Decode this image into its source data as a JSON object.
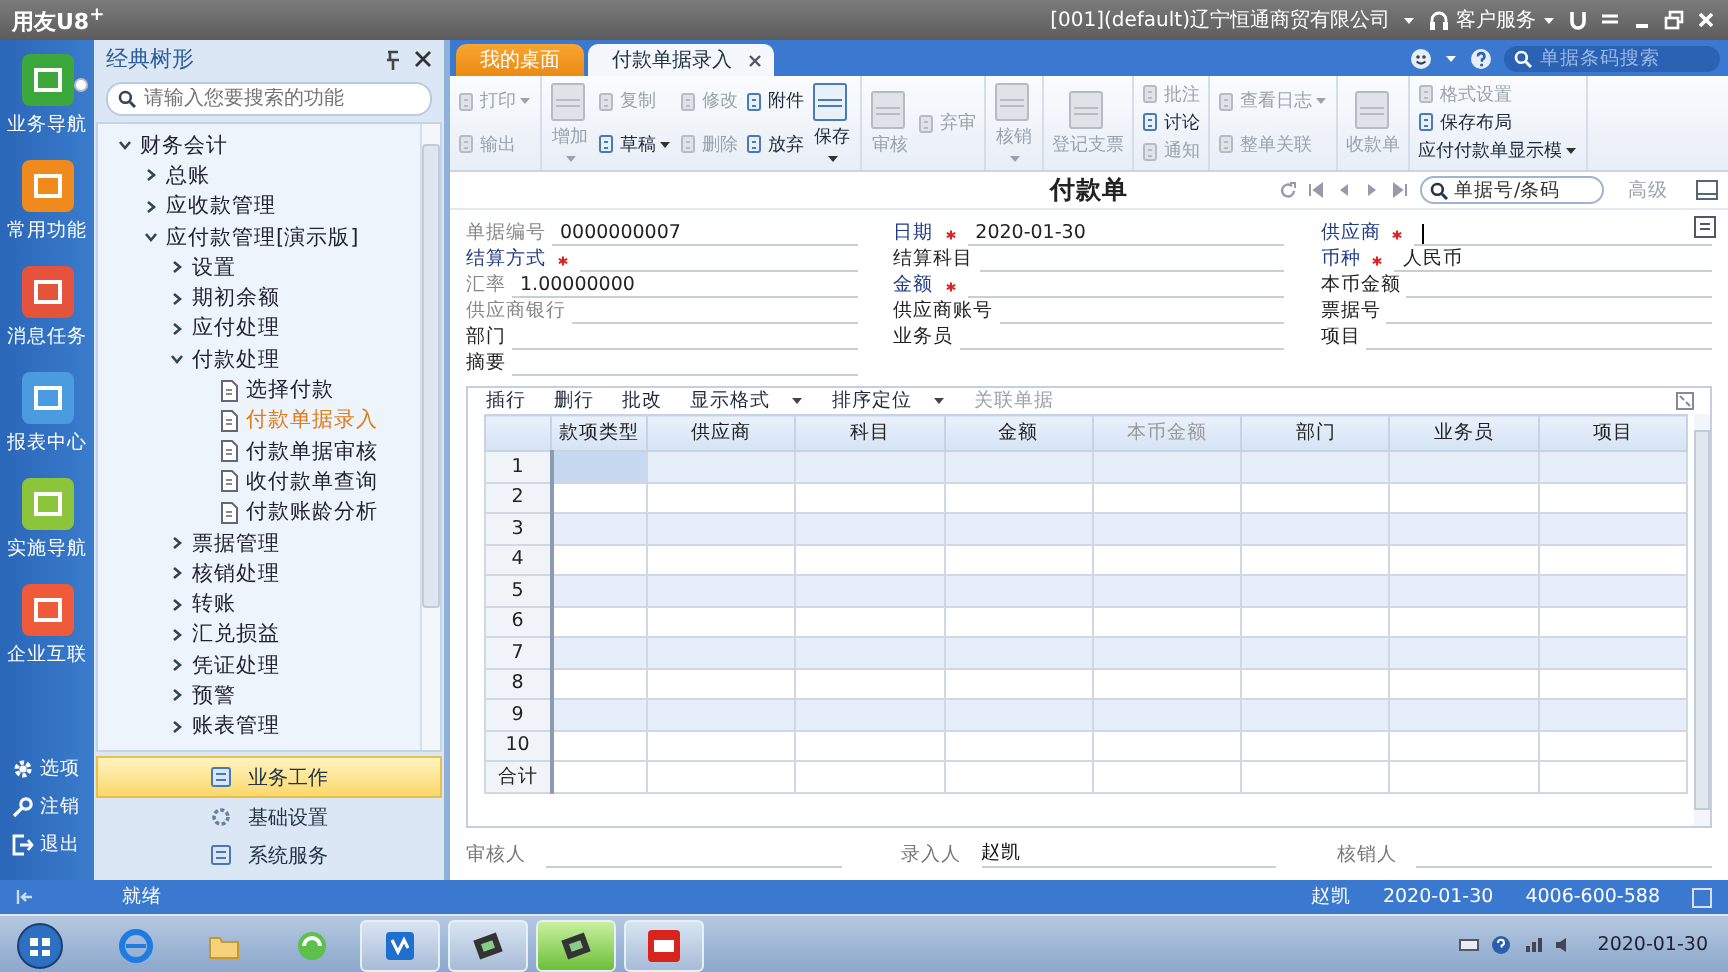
{
  "app": {
    "title": "用友U8$^{+}$",
    "company": "[001](default)辽宁恒通商贸有限公司",
    "service": "客户服务"
  },
  "rail": {
    "items": [
      {
        "label": "业务导航",
        "color": "#3aa83a",
        "selected": true
      },
      {
        "label": "常用功能",
        "color": "#f08a1c",
        "selected": false
      },
      {
        "label": "消息任务",
        "color": "#e5533c",
        "selected": false
      },
      {
        "label": "报表中心",
        "color": "#4a9be0",
        "selected": false
      },
      {
        "label": "实施导航",
        "color": "#8cc43c",
        "selected": false
      },
      {
        "label": "企业互联",
        "color": "#ee5a3a",
        "selected": false
      }
    ],
    "bottom": [
      {
        "label": "选项",
        "kind": "gear"
      },
      {
        "label": "注销",
        "kind": "key"
      },
      {
        "label": "退出",
        "kind": "exit"
      }
    ]
  },
  "tree_panel": {
    "title": "经典树形",
    "search": {
      "placeholder": "请输入您要搜索的功能"
    },
    "tree": [
      {
        "label": "财务会计",
        "kind": "folder",
        "expanded": true,
        "selected": false,
        "children": [
          {
            "label": "总账",
            "kind": "folder",
            "expanded": false,
            "selected": false
          },
          {
            "label": "应收款管理",
            "kind": "folder",
            "expanded": false,
            "selected": false
          },
          {
            "label": "应付款管理[演示版]",
            "kind": "folder",
            "expanded": true,
            "selected": false,
            "children": [
              {
                "label": "设置",
                "kind": "folder",
                "expanded": false,
                "selected": false
              },
              {
                "label": "期初余额",
                "kind": "folder",
                "expanded": false,
                "selected": false
              },
              {
                "label": "应付处理",
                "kind": "folder",
                "expanded": false,
                "selected": false
              },
              {
                "label": "付款处理",
                "kind": "folder",
                "expanded": true,
                "selected": false,
                "children": [
                  {
                    "label": "选择付款",
                    "kind": "leaf",
                    "selected": false
                  },
                  {
                    "label": "付款单据录入",
                    "kind": "leaf",
                    "selected": true
                  },
                  {
                    "label": "付款单据审核",
                    "kind": "leaf",
                    "selected": false
                  },
                  {
                    "label": "收付款单查询",
                    "kind": "leaf",
                    "selected": false
                  },
                  {
                    "label": "付款账龄分析",
                    "kind": "leaf",
                    "selected": false
                  }
                ]
              },
              {
                "label": "票据管理",
                "kind": "folder",
                "expanded": false,
                "selected": false
              },
              {
                "label": "核销处理",
                "kind": "folder",
                "expanded": false,
                "selected": false
              },
              {
                "label": "转账",
                "kind": "folder",
                "expanded": false,
                "selected": false
              },
              {
                "label": "汇兑损益",
                "kind": "folder",
                "expanded": false,
                "selected": false
              },
              {
                "label": "凭证处理",
                "kind": "folder",
                "expanded": false,
                "selected": false
              },
              {
                "label": "预警",
                "kind": "folder",
                "expanded": false,
                "selected": false
              },
              {
                "label": "账表管理",
                "kind": "folder",
                "expanded": false,
                "selected": false
              }
            ]
          }
        ]
      }
    ],
    "modules": [
      {
        "label": "业务工作",
        "selected": true
      },
      {
        "label": "基础设置",
        "selected": false
      },
      {
        "label": "系统服务",
        "selected": false
      }
    ]
  },
  "tabs": [
    {
      "label": "我的桌面",
      "selected": false,
      "closable": false
    },
    {
      "label": "付款单据录入",
      "selected": true,
      "closable": true
    }
  ],
  "header_search": {
    "placeholder": "单据条码搜索"
  },
  "toolbar": {
    "groups": [
      {
        "columns": [
          [
            {
              "label": "打印",
              "kind": "small",
              "disabled": true,
              "dropdown": true
            },
            {
              "label": "输出",
              "kind": "small",
              "disabled": true,
              "dropdown": false
            }
          ]
        ]
      },
      {
        "columns": [
          [
            {
              "label": "增加",
              "kind": "large",
              "disabled": true,
              "dropdown": true
            }
          ],
          [
            {
              "label": "复制",
              "kind": "small",
              "disabled": true,
              "dropdown": false
            },
            {
              "label": "草稿",
              "kind": "small",
              "disabled": false,
              "dropdown": true
            }
          ],
          [
            {
              "label": "修改",
              "kind": "small",
              "disabled": true,
              "dropdown": false
            },
            {
              "label": "删除",
              "kind": "small",
              "disabled": true,
              "dropdown": false
            }
          ],
          [
            {
              "label": "附件",
              "kind": "small",
              "disabled": false,
              "dropdown": false
            },
            {
              "label": "放弃",
              "kind": "small",
              "disabled": false,
              "dropdown": false
            }
          ],
          [
            {
              "label": "保存",
              "kind": "large",
              "disabled": false,
              "dropdown": true
            }
          ]
        ]
      },
      {
        "columns": [
          [
            {
              "label": "审核",
              "kind": "large",
              "disabled": true,
              "dropdown": false
            }
          ],
          [
            {
              "label": "弃审",
              "kind": "small",
              "disabled": true,
              "dropdown": false
            }
          ]
        ]
      },
      {
        "columns": [
          [
            {
              "label": "核销",
              "kind": "large",
              "disabled": true,
              "dropdown": true
            }
          ]
        ]
      },
      {
        "columns": [
          [
            {
              "label": "登记支票",
              "kind": "large",
              "disabled": true,
              "dropdown": false
            }
          ]
        ]
      },
      {
        "columns": [
          [
            {
              "label": "批注",
              "kind": "small",
              "disabled": true,
              "dropdown": false
            },
            {
              "label": "讨论",
              "kind": "small",
              "disabled": false,
              "dropdown": false
            },
            {
              "label": "通知",
              "kind": "small",
              "disabled": true,
              "dropdown": false
            }
          ]
        ]
      },
      {
        "columns": [
          [
            {
              "label": "查看日志",
              "kind": "small",
              "disabled": true,
              "dropdown": true
            },
            {
              "label": "整单关联",
              "kind": "small",
              "disabled": true,
              "dropdown": false
            }
          ]
        ]
      },
      {
        "columns": [
          [
            {
              "label": "收款单",
              "kind": "large",
              "disabled": true,
              "dropdown": false
            }
          ]
        ]
      },
      {
        "columns": [
          [
            {
              "label": "格式设置",
              "kind": "small",
              "disabled": true,
              "dropdown": false
            },
            {
              "label": "保存布局",
              "kind": "small",
              "disabled": false,
              "dropdown": false
            },
            {
              "label": "应付付款单显示模",
              "kind": "text",
              "disabled": false,
              "dropdown": true
            }
          ]
        ]
      }
    ]
  },
  "voucher": {
    "title": "付款单",
    "search": {
      "placeholder": "单据号/条码"
    },
    "advanced": "高级",
    "fields": [
      [
        {
          "label": "单据编号",
          "kind": "readonly",
          "required": false,
          "focused": false,
          "value": "0000000007"
        },
        {
          "label": "日期",
          "kind": "ref",
          "required": true,
          "focused": false,
          "value": "2020-01-30"
        },
        {
          "label": "供应商",
          "kind": "ref",
          "required": true,
          "focused": true
        }
      ],
      [
        {
          "label": "结算方式",
          "kind": "ref",
          "required": true,
          "focused": false
        },
        {
          "label": "结算科目",
          "kind": "plain",
          "required": false,
          "focused": false
        },
        {
          "label": "币种",
          "kind": "ref",
          "required": true,
          "focused": false,
          "value": "人民币"
        }
      ],
      [
        {
          "label": "汇率",
          "kind": "readonly",
          "required": false,
          "focused": false,
          "value": "1.00000000"
        },
        {
          "label": "金额",
          "kind": "ref",
          "required": true,
          "focused": false
        },
        {
          "label": "本币金额",
          "kind": "plain",
          "required": false,
          "focused": false
        }
      ],
      [
        {
          "label": "供应商银行",
          "kind": "readonly",
          "required": false,
          "focused": false
        },
        {
          "label": "供应商账号",
          "kind": "plain",
          "required": false,
          "focused": false
        },
        {
          "label": "票据号",
          "kind": "plain",
          "required": false,
          "focused": false
        }
      ],
      [
        {
          "label": "部门",
          "kind": "plain",
          "required": false,
          "focused": false
        },
        {
          "label": "业务员",
          "kind": "plain",
          "required": false,
          "focused": false
        },
        {
          "label": "项目",
          "kind": "plain",
          "required": false,
          "focused": false
        }
      ],
      [
        {
          "label": "摘要",
          "kind": "plain",
          "required": false,
          "focused": false
        }
      ]
    ]
  },
  "grid": {
    "actions": [
      {
        "label": "插行",
        "disabled": false,
        "dropdown": false
      },
      {
        "label": "删行",
        "disabled": false,
        "dropdown": false
      },
      {
        "label": "批改",
        "disabled": false,
        "dropdown": false
      },
      {
        "label": "显示格式",
        "disabled": false,
        "dropdown": true
      },
      {
        "label": "排序定位",
        "disabled": false,
        "dropdown": true
      },
      {
        "label": "关联单据",
        "disabled": true,
        "dropdown": false
      }
    ],
    "columns": [
      {
        "label": "款项类型",
        "disabled": false
      },
      {
        "label": "供应商",
        "disabled": false
      },
      {
        "label": "科目",
        "disabled": false
      },
      {
        "label": "金额",
        "disabled": false
      },
      {
        "label": "本币金额",
        "disabled": true
      },
      {
        "label": "部门",
        "disabled": false
      },
      {
        "label": "业务员",
        "disabled": false
      },
      {
        "label": "项目",
        "disabled": false
      }
    ],
    "rows": [
      {
        "label": "1",
        "selected": true
      },
      {
        "label": "2",
        "selected": false
      },
      {
        "label": "3",
        "selected": false
      },
      {
        "label": "4",
        "selected": false
      },
      {
        "label": "5",
        "selected": false
      },
      {
        "label": "6",
        "selected": false
      },
      {
        "label": "7",
        "selected": false
      },
      {
        "label": "8",
        "selected": false
      },
      {
        "label": "9",
        "selected": false
      },
      {
        "label": "10",
        "selected": false
      }
    ],
    "total_label": "合计"
  },
  "signatures": [
    {
      "label": "审核人"
    },
    {
      "label": "录入人",
      "value": "赵凯"
    },
    {
      "label": "核销人"
    }
  ],
  "status_bar": {
    "status": "就绪",
    "user": "赵凯",
    "date": "2020-01-30",
    "phone": "4006-600-588"
  },
  "taskbar": {
    "apps": [
      {
        "kind": "browser",
        "running": false,
        "selected": false
      },
      {
        "kind": "folder",
        "running": false,
        "selected": false
      },
      {
        "kind": "refresh",
        "running": false,
        "selected": false
      },
      {
        "kind": "office",
        "running": true,
        "selected": false
      },
      {
        "kind": "chip",
        "running": true,
        "selected": false
      },
      {
        "kind": "chip",
        "running": true,
        "selected": true
      },
      {
        "kind": "u8",
        "running": true,
        "selected": false
      }
    ],
    "clock": "2020-01-30"
  }
}
